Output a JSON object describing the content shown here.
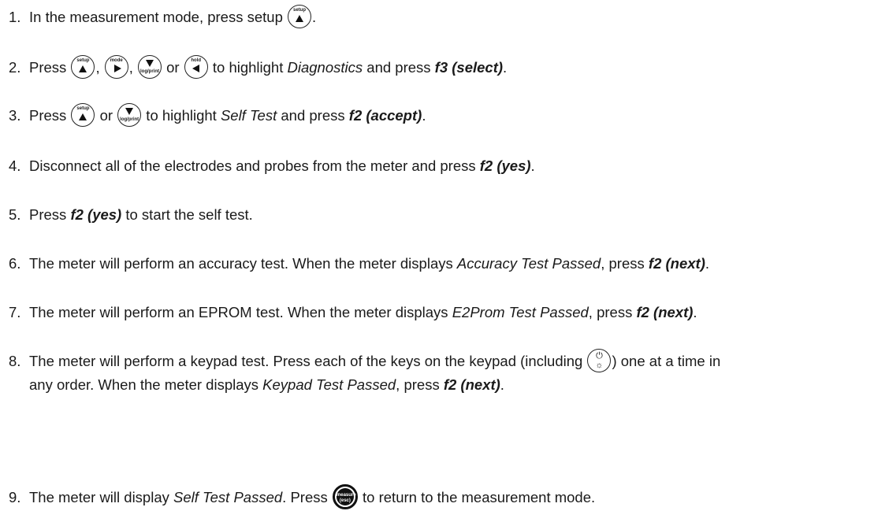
{
  "steps": [
    {
      "num": "1.",
      "t1": "In the measurement mode, press setup ",
      "t2": "."
    },
    {
      "num": "2.",
      "t1": "Press ",
      "sep1": ", ",
      "sep2": ", ",
      "sep3": " or ",
      "t2": " to highlight ",
      "em1": "Diagnostics",
      "t3": " and press ",
      "b1": "f3 (select)",
      "t4": "."
    },
    {
      "num": "3.",
      "t1": "Press ",
      "sep1": " or ",
      "t2": " to highlight ",
      "em1": "Self Test",
      "t3": " and press ",
      "b1": "f2 (accept)",
      "t4": "."
    },
    {
      "num": "4.",
      "t1": "Disconnect all of the electrodes and probes from the meter and press ",
      "b1": "f2 (yes)",
      "t2": "."
    },
    {
      "num": "5.",
      "t1": "Press ",
      "b1": "f2 (yes)",
      "t2": " to start the self test."
    },
    {
      "num": "6.",
      "t1": "The meter will perform an accuracy test. When the meter displays ",
      "em1": "Accuracy Test Passed",
      "t2": ", press ",
      "b1": "f2 (next)",
      "t3": "."
    },
    {
      "num": "7.",
      "t1": "The meter will perform an EPROM test. When the meter displays ",
      "em1": "E2Prom Test Passed",
      "t2": ", press ",
      "b1": "f2 (next)",
      "t3": "."
    },
    {
      "num": "8.",
      "t1": "The meter will perform a keypad test. Press each of the keys on the keypad (including ",
      "t2": ") one at a time in",
      "t3": "any order. When the meter displays ",
      "em1": "Keypad Test Passed",
      "t4": ", press ",
      "b1": "f2 (next)",
      "t5": "."
    },
    {
      "num": "9.",
      "t1": "The meter will display ",
      "em1": "Self Test Passed",
      "t2": ". Press ",
      "t3": " to return to the measurement mode."
    }
  ],
  "keys": {
    "setup": "setup",
    "mode": "mode",
    "logprint": "log/print",
    "hold": "hold",
    "measure_top": "measure",
    "measure_bottom": "(esc)"
  },
  "icons": {
    "setup_key": "up-arrow-icon",
    "mode_key": "right-arrow-icon",
    "logprint_key": "down-arrow-icon",
    "hold_key": "left-arrow-icon",
    "power_key": "power-backlight-icon",
    "measure_key": "measure-esc-icon"
  }
}
